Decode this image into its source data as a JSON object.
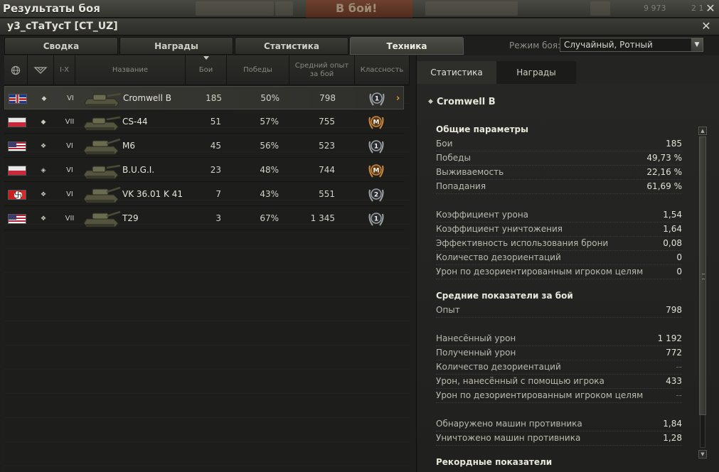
{
  "window": {
    "title": "Результаты боя",
    "player": "у3_сТаТусТ [CT_UZ]",
    "battle_button": "В бой!",
    "res1": "9 973",
    "res2": "2 1"
  },
  "tabs": [
    {
      "label": "Сводка"
    },
    {
      "label": "Награды"
    },
    {
      "label": "Статистика"
    },
    {
      "label": "Техника"
    }
  ],
  "active_tab": 3,
  "mode": {
    "label": "Режим боя:",
    "value": "Случайный, Ротный"
  },
  "table": {
    "headers": {
      "tier": "I-X",
      "name": "Название",
      "battles": "Бои",
      "wins": "Победы",
      "avg_xp": "Средний опыт за бой",
      "mastery": "Классность"
    },
    "rows": [
      {
        "nation": "uk",
        "type": "light-tank",
        "tier": "VI",
        "name": "Cromwell B",
        "battles": "185",
        "wins": "50%",
        "avg_xp": "798",
        "mastery": "1",
        "selected": true
      },
      {
        "nation": "pl",
        "type": "light-tank",
        "tier": "VII",
        "name": "CS-44",
        "battles": "51",
        "wins": "57%",
        "avg_xp": "755",
        "mastery": "M"
      },
      {
        "nation": "us",
        "type": "heavy-tank",
        "tier": "VI",
        "name": "M6",
        "battles": "45",
        "wins": "56%",
        "avg_xp": "523",
        "mastery": "1"
      },
      {
        "nation": "pl",
        "type": "medium-tank",
        "tier": "VI",
        "name": "B.U.G.I.",
        "battles": "23",
        "wins": "48%",
        "avg_xp": "744",
        "mastery": "M"
      },
      {
        "nation": "de",
        "type": "heavy-tank",
        "tier": "VI",
        "name": "VK 36.01 K 41",
        "battles": "7",
        "wins": "43%",
        "avg_xp": "551",
        "mastery": "2"
      },
      {
        "nation": "us",
        "type": "heavy-tank",
        "tier": "VII",
        "name": "T29",
        "battles": "3",
        "wins": "67%",
        "avg_xp": "1 345",
        "mastery": "1"
      }
    ]
  },
  "right": {
    "tabs": [
      {
        "label": "Статистика"
      },
      {
        "label": "Награды"
      }
    ],
    "vehicle": "Cromwell B",
    "sections": [
      {
        "title": "Общие параметры"
      },
      {
        "title": "Средние показатели за бой"
      },
      {
        "title": "Рекордные показатели"
      }
    ],
    "stats": [
      {
        "label": "Бои",
        "value": "185"
      },
      {
        "label": "Победы",
        "value": "49,73 %"
      },
      {
        "label": "Выживаемость",
        "value": "22,16 %"
      },
      {
        "label": "Попадания",
        "value": "61,69 %"
      },
      {
        "label": "Коэффициент урона",
        "value": "1,54"
      },
      {
        "label": "Коэффициент уничтожения",
        "value": "1,64"
      },
      {
        "label": "Эффективность использования брони",
        "value": "0,08"
      },
      {
        "label": "Количество дезориентаций",
        "value": "0"
      },
      {
        "label": "Урон по дезориентированным игроком целям",
        "value": "0"
      },
      {
        "label": "Опыт",
        "value": "798"
      },
      {
        "label": "Нанесённый урон",
        "value": "1 192"
      },
      {
        "label": "Полученный урон",
        "value": "772"
      },
      {
        "label": "Количество дезориентаций",
        "value": "--",
        "dim": true
      },
      {
        "label": "Урон, нанесённый с помощью игрока",
        "value": "433"
      },
      {
        "label": "Урон по дезориентированным игроком целям",
        "value": "--",
        "dim": true
      },
      {
        "label": "Обнаружено машин противника",
        "value": "1,84"
      },
      {
        "label": "Уничтожено машин противника",
        "value": "1,28"
      }
    ]
  },
  "colors": {
    "accent": "#e0a030",
    "bg": "#1e1e1c",
    "battle_btn": "#8a3a1e"
  }
}
